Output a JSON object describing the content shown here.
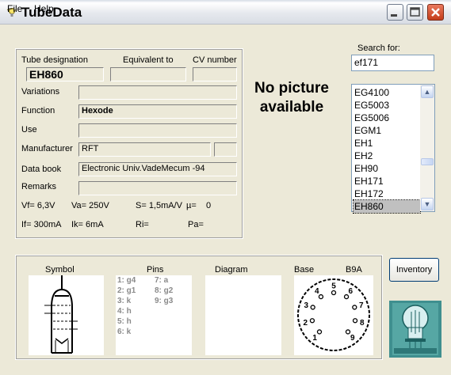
{
  "window": {
    "title": "TubeData"
  },
  "menu": {
    "file": "File",
    "help": "Help"
  },
  "labels": {
    "tube_designation": "Tube designation",
    "equivalent_to": "Equivalent to",
    "cv_number": "CV number",
    "variations": "Variations",
    "function": "Function",
    "use": "Use",
    "manufacturer": "Manufacturer",
    "data_book": "Data book",
    "remarks": "Remarks",
    "search_for": "Search for:",
    "no_picture": "No picture available",
    "symbol": "Symbol",
    "pins": "Pins",
    "diagram": "Diagram",
    "base": "Base",
    "base_type": "B9A"
  },
  "fields": {
    "tube_designation": "EH860",
    "equivalent_to": "",
    "cv_number": "",
    "variations": "",
    "function": "Hexode",
    "use": "",
    "manufacturer": "RFT",
    "manufacturer_extra": "",
    "data_book": "Electronic Univ.VadeMecum -94",
    "remarks": ""
  },
  "params": {
    "vf": "Vf= 6,3V",
    "va": "Va= 250V",
    "s": "S= 1,5mA/V",
    "mu": "µ=",
    "mu_val": "0",
    "if": "If= 300mA",
    "ik": "Ik= 6mA",
    "ri": "Ri=",
    "pa": "Pa="
  },
  "search": {
    "value": "ef171"
  },
  "tube_list": {
    "items": [
      "EG4100",
      "EG5003",
      "EG5006",
      "EGM1",
      "EH1",
      "EH2",
      "EH90",
      "EH171",
      "EH172",
      "EH860"
    ],
    "selected": "EH860"
  },
  "pins": {
    "col1": [
      "1: g4",
      "2: g1",
      "3: k",
      "4: h",
      "5: h",
      "6: k"
    ],
    "col2": [
      "7: a",
      "8: g2",
      "9: g3"
    ]
  },
  "base_pin_numbers": [
    "1",
    "2",
    "3",
    "4",
    "5",
    "6",
    "7",
    "8",
    "9"
  ],
  "buttons": {
    "inventory": "Inventory"
  },
  "colors": {
    "window_bg": "#ECE9D8",
    "close_button": "#C43C1A",
    "list_selection": "#C0C0C0"
  }
}
